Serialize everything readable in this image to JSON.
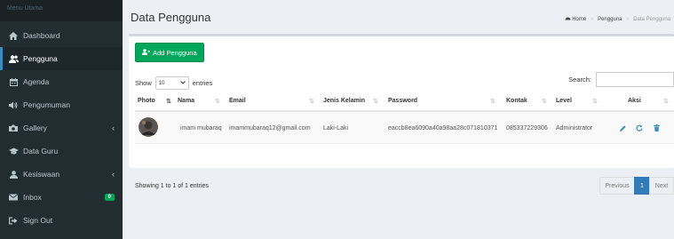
{
  "sidebar": {
    "header": "Menu Utama",
    "items": [
      {
        "label": "Dashboard",
        "icon": "home-icon"
      },
      {
        "label": "Pengguna",
        "icon": "users-icon"
      },
      {
        "label": "Agenda",
        "icon": "calendar-icon"
      },
      {
        "label": "Pengumuman",
        "icon": "volume-icon"
      },
      {
        "label": "Gallery",
        "icon": "camera-icon"
      },
      {
        "label": "Data Guru",
        "icon": "graduation-cap-icon"
      },
      {
        "label": "Kesiswaan",
        "icon": "user-icon"
      },
      {
        "label": "Inbox",
        "icon": "envelope-icon",
        "badge": "0"
      },
      {
        "label": "Sign Out",
        "icon": "sign-out-icon"
      }
    ]
  },
  "header": {
    "title": "Data Pengguna",
    "breadcrumb": [
      "Home",
      "Pengguna",
      "Data Pengguna"
    ]
  },
  "toolbar": {
    "add_label": "Add Pengguna",
    "show_label": "Show",
    "entries_value": "10",
    "entries_label": "entries",
    "search_label": "Search:"
  },
  "table": {
    "columns": [
      "Photo",
      "Nama",
      "Email",
      "Jenis Kelamin",
      "Password",
      "Kontak",
      "Level",
      "Aksi"
    ],
    "rows": [
      {
        "nama": "imam mubaraq",
        "email": "imammubaraq12@gmail.com",
        "jenis_kelamin": "Laki-Laki",
        "password": "eaccb8ea6090a40a98aa28c071810371",
        "kontak": "085337229306",
        "level": "Administrator"
      }
    ]
  },
  "footer": {
    "info": "Showing 1 to 1 of 1 entries",
    "previous": "Previous",
    "current_page": "1",
    "next": "Next"
  },
  "colors": {
    "sidebar_bg": "#222d32",
    "accent": "#3c8dbc",
    "success": "#00a65a",
    "pager_active": "#337ab7"
  }
}
